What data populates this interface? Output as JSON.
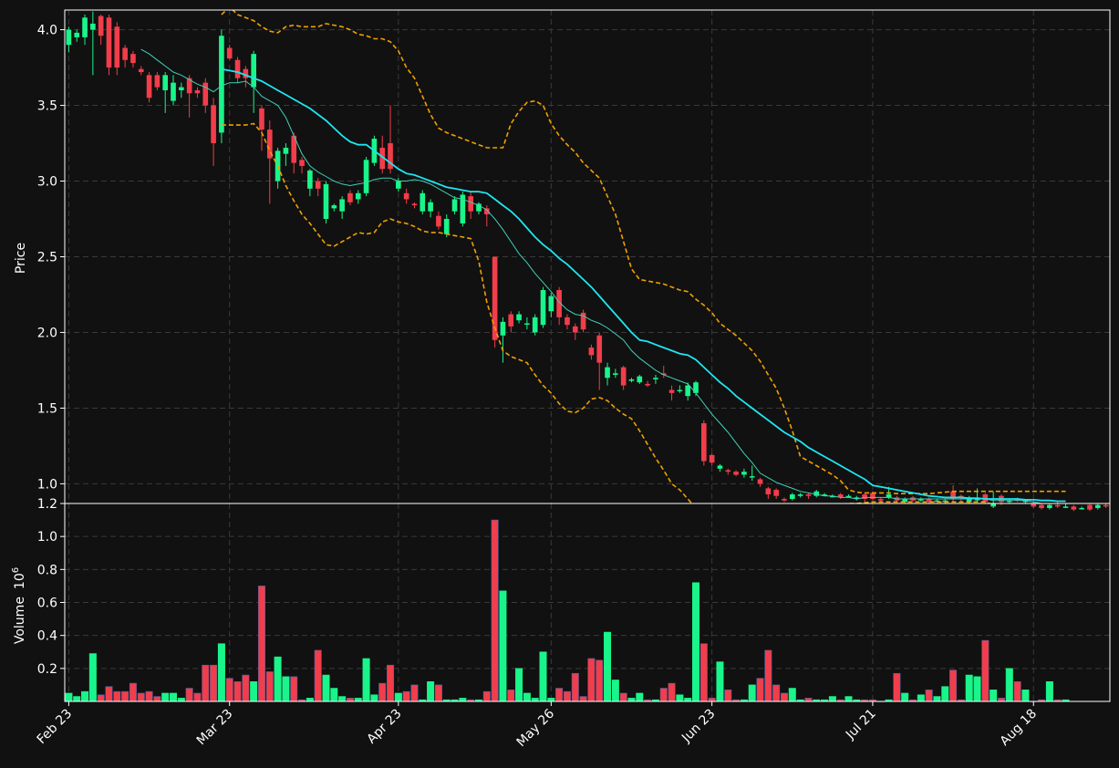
{
  "chart_data": {
    "type": "candlestick",
    "ylabel_price": "Price",
    "ylabel_volume": "Volume",
    "volume_exponent_base": "10",
    "volume_exponent": "6",
    "price_ylim": [
      0.87,
      4.13
    ],
    "volume_ylim": [
      0,
      1.2
    ],
    "price_ticks": [
      "1.0",
      "1.5",
      "2.0",
      "2.5",
      "3.0",
      "3.5",
      "4.0"
    ],
    "volume_ticks": [
      "0.2",
      "0.4",
      "0.6",
      "0.8",
      "1.0",
      "1.2"
    ],
    "x_ticks": [
      {
        "label": "Feb 23",
        "index": 0
      },
      {
        "label": "Mar 23",
        "index": 20
      },
      {
        "label": "Apr 23",
        "index": 41
      },
      {
        "label": "May 26",
        "index": 60
      },
      {
        "label": "Jun 23",
        "index": 80
      },
      {
        "label": "Jul 21",
        "index": 100
      },
      {
        "label": "Aug 18",
        "index": 120
      }
    ],
    "grid": true,
    "colors": {
      "background": "#111111",
      "up": "#19f58a",
      "down": "#f23d4b",
      "ma_slow": "#1ee6f0",
      "ma_fast": "#40d0b8",
      "bands": "#f0a000",
      "grid": "#3a3a3a",
      "axis": "#ffffff"
    },
    "candles": [
      [
        3.9,
        4.0,
        4.02,
        3.85
      ],
      [
        3.95,
        3.98,
        4.0,
        3.92
      ],
      [
        3.95,
        4.08,
        4.1,
        3.9
      ],
      [
        4.0,
        4.04,
        4.12,
        3.7
      ],
      [
        4.09,
        3.96,
        4.1,
        3.9
      ],
      [
        4.08,
        3.75,
        4.1,
        3.7
      ],
      [
        4.02,
        3.75,
        4.05,
        3.7
      ],
      [
        3.88,
        3.8,
        3.9,
        3.75
      ],
      [
        3.84,
        3.78,
        3.86,
        3.75
      ],
      [
        3.74,
        3.72,
        3.76,
        3.7
      ],
      [
        3.7,
        3.55,
        3.72,
        3.52
      ],
      [
        3.7,
        3.62,
        3.72,
        3.6
      ],
      [
        3.6,
        3.7,
        3.72,
        3.45
      ],
      [
        3.53,
        3.65,
        3.7,
        3.5
      ],
      [
        3.6,
        3.62,
        3.65,
        3.55
      ],
      [
        3.68,
        3.58,
        3.7,
        3.42
      ],
      [
        3.6,
        3.58,
        3.62,
        3.55
      ],
      [
        3.65,
        3.5,
        3.68,
        3.45
      ],
      [
        3.5,
        3.25,
        3.55,
        3.1
      ],
      [
        3.32,
        3.96,
        4.0,
        3.25
      ],
      [
        3.88,
        3.81,
        3.9,
        3.8
      ],
      [
        3.8,
        3.68,
        3.82,
        3.65
      ],
      [
        3.74,
        3.68,
        3.76,
        3.62
      ],
      [
        3.62,
        3.84,
        3.86,
        3.45
      ],
      [
        3.48,
        3.34,
        3.5,
        3.2
      ],
      [
        3.34,
        3.15,
        3.4,
        2.85
      ],
      [
        3.0,
        3.2,
        3.22,
        2.95
      ],
      [
        3.18,
        3.22,
        3.25,
        3.1
      ],
      [
        3.3,
        3.12,
        3.32,
        3.05
      ],
      [
        3.14,
        3.1,
        3.16,
        3.05
      ],
      [
        2.95,
        3.07,
        3.08,
        2.9
      ],
      [
        3.0,
        2.95,
        3.02,
        2.9
      ],
      [
        2.75,
        2.98,
        3.0,
        2.72
      ],
      [
        2.82,
        2.84,
        2.85,
        2.8
      ],
      [
        2.8,
        2.88,
        2.9,
        2.75
      ],
      [
        2.92,
        2.86,
        2.94,
        2.84
      ],
      [
        2.88,
        2.92,
        2.94,
        2.85
      ],
      [
        2.92,
        3.14,
        3.16,
        2.9
      ],
      [
        3.12,
        3.28,
        3.3,
        3.1
      ],
      [
        3.22,
        3.08,
        3.3,
        3.05
      ],
      [
        3.25,
        3.08,
        3.5,
        3.05
      ],
      [
        2.95,
        3.0,
        3.02,
        2.93
      ],
      [
        2.92,
        2.88,
        2.95,
        2.85
      ],
      [
        2.85,
        2.84,
        2.86,
        2.82
      ],
      [
        2.8,
        2.92,
        2.94,
        2.78
      ],
      [
        2.8,
        2.86,
        2.88,
        2.76
      ],
      [
        2.77,
        2.7,
        2.8,
        2.68
      ],
      [
        2.65,
        2.75,
        2.78,
        2.63
      ],
      [
        2.8,
        2.88,
        2.9,
        2.78
      ],
      [
        2.72,
        2.91,
        2.93,
        2.7
      ],
      [
        2.9,
        2.8,
        2.93,
        2.75
      ],
      [
        2.8,
        2.85,
        2.86,
        2.78
      ],
      [
        2.82,
        2.78,
        2.84,
        2.7
      ],
      [
        2.5,
        1.95,
        2.5,
        1.9
      ],
      [
        1.98,
        2.07,
        2.1,
        1.8
      ],
      [
        2.12,
        2.04,
        2.14,
        2.0
      ],
      [
        2.08,
        2.12,
        2.14,
        2.06
      ],
      [
        2.06,
        2.06,
        2.1,
        2.02
      ],
      [
        2.0,
        2.1,
        2.12,
        1.98
      ],
      [
        2.05,
        2.28,
        2.3,
        2.03
      ],
      [
        2.14,
        2.24,
        2.26,
        2.1
      ],
      [
        2.28,
        2.1,
        2.3,
        2.05
      ],
      [
        2.1,
        2.05,
        2.12,
        2.02
      ],
      [
        2.04,
        2.0,
        2.06,
        1.95
      ],
      [
        2.13,
        2.02,
        2.15,
        2.0
      ],
      [
        1.9,
        1.85,
        1.92,
        1.82
      ],
      [
        1.98,
        1.8,
        2.0,
        1.62
      ],
      [
        1.7,
        1.77,
        1.8,
        1.65
      ],
      [
        1.72,
        1.73,
        1.76,
        1.7
      ],
      [
        1.77,
        1.65,
        1.78,
        1.62
      ],
      [
        1.68,
        1.69,
        1.7,
        1.67
      ],
      [
        1.67,
        1.71,
        1.72,
        1.66
      ],
      [
        1.66,
        1.65,
        1.68,
        1.64
      ],
      [
        1.69,
        1.7,
        1.72,
        1.66
      ],
      [
        1.73,
        1.72,
        1.78,
        1.7
      ],
      [
        1.62,
        1.6,
        1.65,
        1.55
      ],
      [
        1.62,
        1.62,
        1.65,
        1.6
      ],
      [
        1.58,
        1.65,
        1.67,
        1.55
      ],
      [
        1.6,
        1.67,
        1.68,
        1.58
      ],
      [
        1.4,
        1.15,
        1.42,
        1.12
      ],
      [
        1.19,
        1.14,
        1.2,
        1.12
      ],
      [
        1.1,
        1.12,
        1.13,
        1.08
      ],
      [
        1.09,
        1.08,
        1.1,
        1.06
      ],
      [
        1.08,
        1.06,
        1.09,
        1.05
      ],
      [
        1.06,
        1.08,
        1.1,
        1.04
      ],
      [
        1.05,
        1.05,
        1.12,
        1.02
      ],
      [
        1.03,
        1.0,
        1.04,
        0.98
      ],
      [
        0.97,
        0.93,
        0.98,
        0.9
      ],
      [
        0.96,
        0.92,
        0.97,
        0.9
      ],
      [
        0.9,
        0.89,
        0.91,
        0.88
      ],
      [
        0.9,
        0.93,
        0.94,
        0.89
      ],
      [
        0.92,
        0.93,
        0.94,
        0.91
      ],
      [
        0.93,
        0.92,
        0.94,
        0.9
      ],
      [
        0.92,
        0.95,
        0.96,
        0.91
      ],
      [
        0.93,
        0.93,
        0.94,
        0.92
      ],
      [
        0.92,
        0.92,
        0.93,
        0.91
      ],
      [
        0.93,
        0.91,
        0.94,
        0.9
      ],
      [
        0.92,
        0.92,
        0.93,
        0.91
      ],
      [
        0.9,
        0.91,
        0.92,
        0.89
      ],
      [
        0.93,
        0.9,
        0.94,
        0.88
      ],
      [
        0.94,
        0.9,
        0.95,
        0.89
      ],
      [
        0.9,
        0.89,
        0.91,
        0.88
      ],
      [
        0.91,
        0.93,
        0.98,
        0.9
      ],
      [
        0.91,
        0.89,
        0.92,
        0.88
      ],
      [
        0.88,
        0.9,
        0.91,
        0.87
      ],
      [
        0.91,
        0.89,
        0.92,
        0.88
      ],
      [
        0.89,
        0.9,
        0.91,
        0.88
      ],
      [
        0.9,
        0.88,
        0.91,
        0.87
      ],
      [
        0.89,
        0.89,
        0.9,
        0.88
      ],
      [
        0.88,
        0.89,
        0.9,
        0.87
      ],
      [
        0.95,
        0.9,
        0.99,
        0.88
      ],
      [
        0.92,
        0.91,
        0.93,
        0.88
      ],
      [
        0.88,
        0.91,
        0.92,
        0.87
      ],
      [
        0.9,
        0.9,
        0.97,
        0.88
      ],
      [
        0.93,
        0.88,
        0.94,
        0.87
      ],
      [
        0.85,
        0.87,
        0.95,
        0.84
      ],
      [
        0.92,
        0.88,
        0.93,
        0.86
      ],
      [
        0.88,
        0.89,
        0.9,
        0.87
      ],
      [
        0.9,
        0.89,
        0.91,
        0.88
      ],
      [
        0.88,
        0.89,
        0.9,
        0.87
      ],
      [
        0.87,
        0.85,
        0.89,
        0.84
      ],
      [
        0.86,
        0.84,
        0.87,
        0.83
      ],
      [
        0.84,
        0.86,
        0.87,
        0.83
      ],
      [
        0.86,
        0.85,
        0.88,
        0.84
      ],
      [
        0.85,
        0.85,
        0.87,
        0.84
      ],
      [
        0.85,
        0.83,
        0.86,
        0.82
      ],
      [
        0.84,
        0.84,
        0.85,
        0.83
      ],
      [
        0.86,
        0.83,
        0.87,
        0.82
      ],
      [
        0.84,
        0.86,
        0.87,
        0.83
      ],
      [
        0.86,
        0.85,
        0.87,
        0.84
      ]
    ],
    "volume": [
      0.05,
      0.03,
      0.06,
      0.29,
      0.04,
      0.09,
      0.06,
      0.06,
      0.11,
      0.05,
      0.06,
      0.03,
      0.05,
      0.05,
      0.02,
      0.08,
      0.05,
      0.22,
      0.22,
      0.35,
      0.14,
      0.12,
      0.16,
      0.12,
      0.7,
      0.18,
      0.27,
      0.15,
      0.15,
      0.01,
      0.02,
      0.31,
      0.16,
      0.08,
      0.03,
      0.02,
      0.02,
      0.26,
      0.04,
      0.11,
      0.22,
      0.05,
      0.06,
      0.1,
      0.01,
      0.12,
      0.1,
      0.01,
      0.01,
      0.02,
      0.01,
      0.01,
      0.06,
      1.1,
      0.67,
      0.07,
      0.2,
      0.05,
      0.02,
      0.3,
      0.02,
      0.08,
      0.06,
      0.17,
      0.03,
      0.26,
      0.25,
      0.42,
      0.13,
      0.05,
      0.02,
      0.05,
      0.01,
      0.01,
      0.08,
      0.11,
      0.04,
      0.02,
      0.72,
      0.35,
      0.02,
      0.24,
      0.07,
      0.01,
      0.01,
      0.1,
      0.14,
      0.31,
      0.1,
      0.05,
      0.08,
      0.01,
      0.02,
      0.01,
      0.01,
      0.03,
      0.01,
      0.03,
      0.01,
      0.01,
      0.01,
      0.0,
      0.01,
      0.17,
      0.05,
      0.01,
      0.04,
      0.07,
      0.03,
      0.09,
      0.19,
      0.01,
      0.16,
      0.15,
      0.37,
      0.07,
      0.02,
      0.2,
      0.12,
      0.07,
      0.0,
      0.01,
      0.12,
      0.01,
      0.01
    ],
    "ma_slow": [
      null,
      null,
      null,
      null,
      null,
      null,
      null,
      null,
      null,
      null,
      null,
      null,
      null,
      null,
      null,
      null,
      null,
      null,
      null,
      3.74,
      3.73,
      3.72,
      3.7,
      3.68,
      3.66,
      3.63,
      3.6,
      3.57,
      3.54,
      3.51,
      3.48,
      3.44,
      3.4,
      3.35,
      3.3,
      3.26,
      3.24,
      3.24,
      3.2,
      3.16,
      3.12,
      3.08,
      3.05,
      3.04,
      3.02,
      3.0,
      2.98,
      2.96,
      2.95,
      2.94,
      2.93,
      2.93,
      2.92,
      2.88,
      2.84,
      2.8,
      2.75,
      2.69,
      2.63,
      2.58,
      2.54,
      2.49,
      2.45,
      2.4,
      2.35,
      2.3,
      2.24,
      2.18,
      2.12,
      2.06,
      2.0,
      1.95,
      1.94,
      1.92,
      1.9,
      1.88,
      1.86,
      1.85,
      1.82,
      1.77,
      1.72,
      1.67,
      1.63,
      1.58,
      1.54,
      1.5,
      1.46,
      1.42,
      1.38,
      1.34,
      1.31,
      1.28,
      1.24,
      1.21,
      1.18,
      1.15,
      1.12,
      1.09,
      1.06,
      1.03,
      0.99,
      0.98,
      0.97,
      0.96,
      0.95,
      0.94,
      0.93,
      0.92,
      0.915,
      0.91,
      0.91,
      0.91,
      0.905,
      0.905,
      0.9,
      0.9,
      0.9,
      0.9,
      0.9,
      0.895,
      0.895,
      0.89,
      0.89,
      0.885,
      0.885
    ],
    "ma_fast": [
      null,
      null,
      null,
      null,
      null,
      null,
      null,
      null,
      null,
      3.87,
      3.84,
      3.8,
      3.76,
      3.72,
      3.7,
      3.67,
      3.64,
      3.62,
      3.59,
      3.63,
      3.65,
      3.65,
      3.66,
      3.62,
      3.56,
      3.53,
      3.5,
      3.42,
      3.3,
      3.18,
      3.1,
      3.06,
      3.03,
      3.0,
      2.98,
      2.97,
      2.98,
      2.99,
      3.01,
      3.02,
      3.02,
      3.0,
      3.0,
      3.01,
      3.0,
      2.98,
      2.95,
      2.92,
      2.89,
      2.88,
      2.86,
      2.84,
      2.81,
      2.75,
      2.68,
      2.6,
      2.52,
      2.46,
      2.39,
      2.33,
      2.27,
      2.2,
      2.15,
      2.12,
      2.11,
      2.08,
      2.06,
      2.03,
      1.99,
      1.95,
      1.88,
      1.83,
      1.79,
      1.75,
      1.72,
      1.7,
      1.68,
      1.66,
      1.6,
      1.53,
      1.46,
      1.4,
      1.34,
      1.27,
      1.2,
      1.14,
      1.07,
      1.04,
      1.01,
      0.99,
      0.97,
      0.95,
      0.94,
      0.93,
      0.92,
      0.92,
      0.91,
      0.91,
      0.9,
      0.91,
      0.91,
      0.91,
      0.91,
      0.9,
      0.9,
      0.9,
      0.9,
      0.9,
      0.9,
      0.9,
      0.9,
      0.9,
      0.9,
      0.9,
      0.9,
      0.89,
      0.89,
      0.89,
      0.89,
      0.89,
      0.88,
      0.87,
      0.87,
      0.87,
      0.87
    ],
    "band_upper": [
      null,
      null,
      null,
      null,
      null,
      null,
      null,
      null,
      null,
      null,
      null,
      null,
      null,
      null,
      null,
      null,
      null,
      null,
      null,
      4.1,
      4.15,
      4.1,
      4.08,
      4.06,
      4.02,
      3.99,
      3.98,
      4.02,
      4.03,
      4.02,
      4.02,
      4.02,
      4.04,
      4.03,
      4.02,
      4.0,
      3.97,
      3.96,
      3.94,
      3.94,
      3.92,
      3.86,
      3.75,
      3.68,
      3.56,
      3.44,
      3.35,
      3.32,
      3.3,
      3.28,
      3.26,
      3.24,
      3.22,
      3.22,
      3.22,
      3.38,
      3.46,
      3.52,
      3.53,
      3.5,
      3.38,
      3.3,
      3.24,
      3.19,
      3.12,
      3.07,
      3.02,
      2.9,
      2.78,
      2.6,
      2.42,
      2.35,
      2.34,
      2.33,
      2.32,
      2.3,
      2.28,
      2.27,
      2.22,
      2.18,
      2.13,
      2.06,
      2.02,
      1.98,
      1.93,
      1.88,
      1.81,
      1.72,
      1.63,
      1.5,
      1.35,
      1.18,
      1.15,
      1.12,
      1.09,
      1.06,
      1.02,
      0.96,
      0.945,
      0.94,
      0.94,
      0.94,
      0.94,
      0.935,
      0.935,
      0.935,
      0.935,
      0.935,
      0.94,
      0.945,
      0.95,
      0.95,
      0.95,
      0.95,
      0.95,
      0.95,
      0.95,
      0.95,
      0.95,
      0.95,
      0.95,
      0.95,
      0.95,
      0.95,
      0.95
    ],
    "band_lower": [
      null,
      null,
      null,
      null,
      null,
      null,
      null,
      null,
      null,
      null,
      null,
      null,
      null,
      null,
      null,
      null,
      null,
      null,
      null,
      3.37,
      3.37,
      3.37,
      3.37,
      3.38,
      3.32,
      3.2,
      3.1,
      2.97,
      2.87,
      2.78,
      2.72,
      2.65,
      2.58,
      2.57,
      2.6,
      2.63,
      2.66,
      2.65,
      2.66,
      2.73,
      2.75,
      2.73,
      2.72,
      2.7,
      2.67,
      2.66,
      2.66,
      2.65,
      2.64,
      2.63,
      2.62,
      2.47,
      2.2,
      2.03,
      1.88,
      1.84,
      1.82,
      1.8,
      1.72,
      1.65,
      1.6,
      1.53,
      1.48,
      1.47,
      1.5,
      1.56,
      1.57,
      1.55,
      1.5,
      1.46,
      1.43,
      1.35,
      1.26,
      1.17,
      1.09,
      1.0,
      0.96,
      0.9,
      0.84,
      0.78,
      0.71,
      0.63,
      0.6,
      0.58,
      0.59,
      0.62,
      0.68,
      0.72,
      0.77,
      0.81,
      0.84,
      0.85,
      0.85,
      0.85,
      0.86,
      0.86,
      0.865,
      0.87,
      0.87,
      0.875,
      0.88,
      0.88,
      0.88,
      0.88,
      0.88,
      0.88,
      0.88,
      0.88,
      0.88,
      0.88,
      0.88,
      0.88,
      0.88,
      0.88,
      0.88,
      0.86,
      0.85,
      0.85,
      0.85,
      0.85,
      0.85,
      0.85,
      0.84,
      0.84,
      0.84
    ]
  }
}
